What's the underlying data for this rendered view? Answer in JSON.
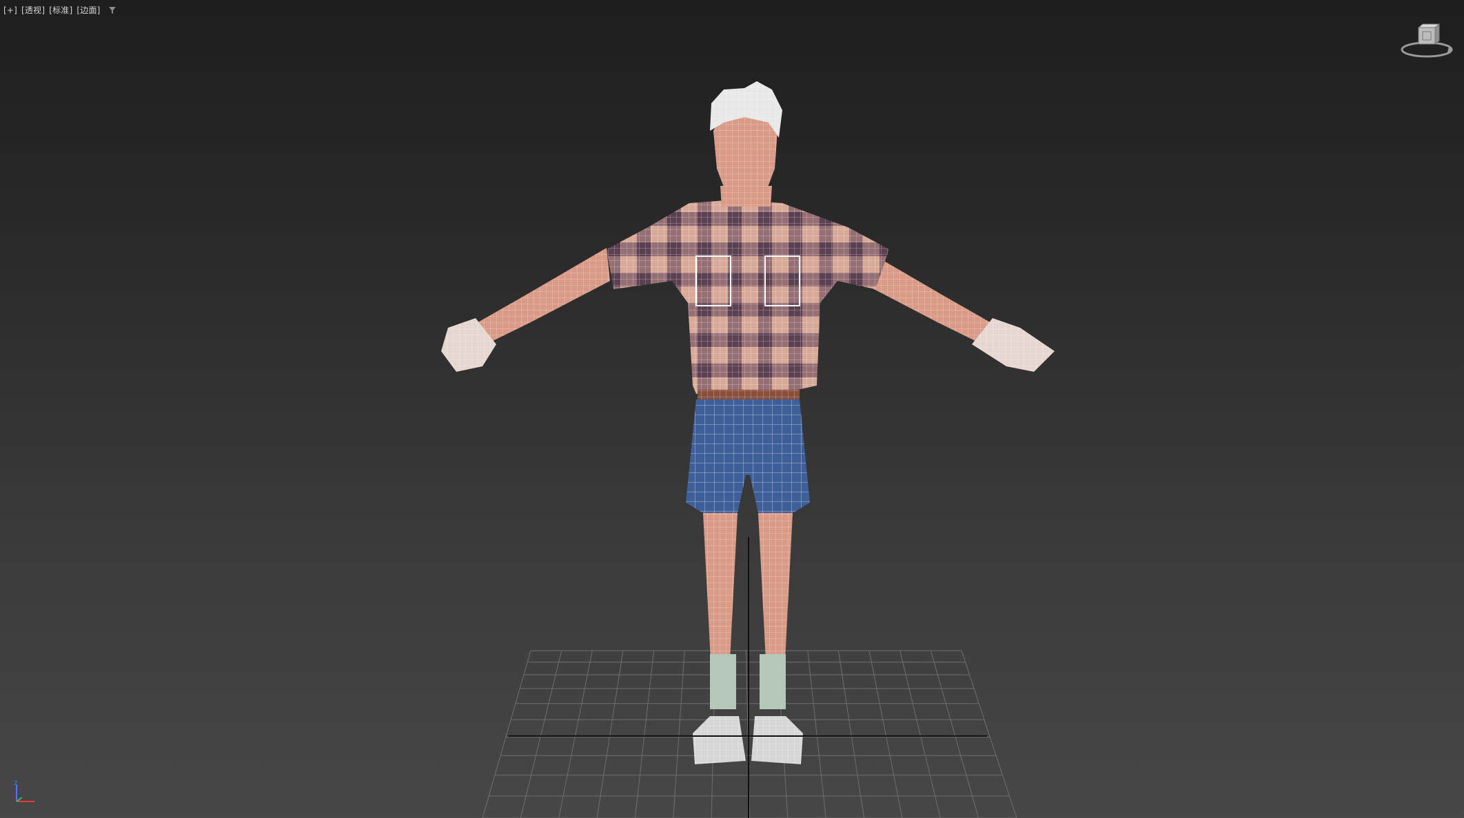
{
  "viewport": {
    "labels": [
      "[+]",
      "[透视]",
      "[标准]",
      "[边面]"
    ],
    "filter_icon": "filter-icon",
    "viewcube_icon": "viewcube-home-icon",
    "axis_icon": "axis-tripod-icon"
  },
  "colors": {
    "background_top": "#1e1e1e",
    "background_bottom": "#474747",
    "grid_line": "#6f6f6f",
    "axis_line": "#111111",
    "wire": "#ffffff",
    "skin": "#d99a86",
    "shirt": "#8a5f6a",
    "shorts": "#3d5e96",
    "hair": "#e8e8e8"
  }
}
